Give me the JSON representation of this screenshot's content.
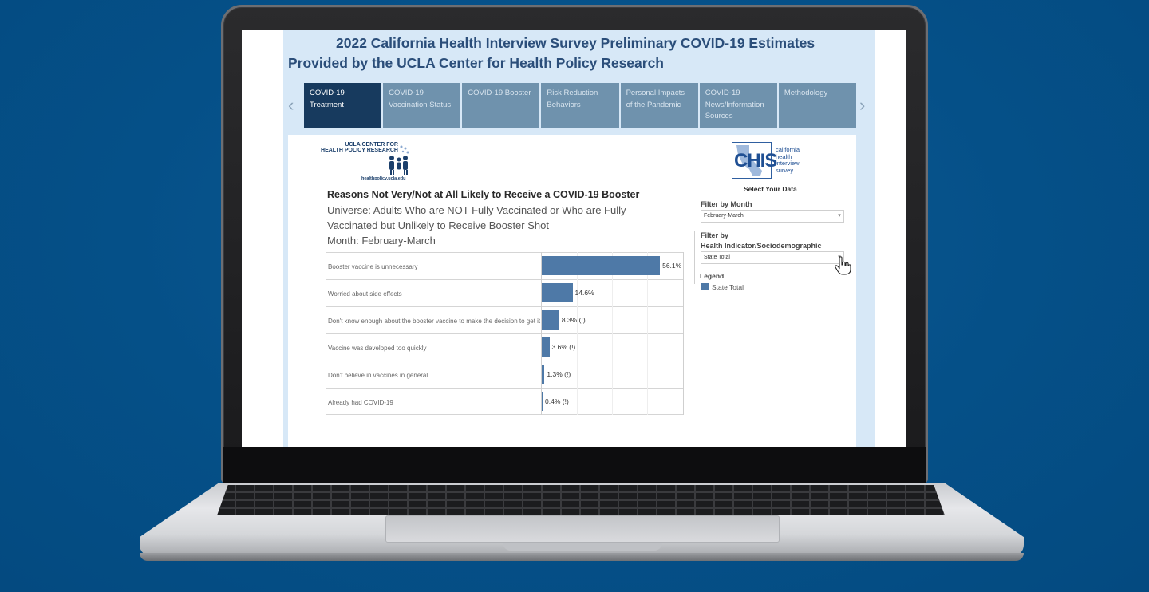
{
  "header": {
    "title_line1": "2022 California Health Interview Survey Preliminary COVID-19 Estimates",
    "title_line2": "Provided by the UCLA Center for Health Policy Research"
  },
  "tabs": [
    {
      "label": "COVID-19 Treatment",
      "active": true
    },
    {
      "label": "COVID-19 Vaccination Status",
      "active": false
    },
    {
      "label": "COVID-19 Booster",
      "active": false
    },
    {
      "label": "Risk Reduction Behaviors",
      "active": false
    },
    {
      "label": "Personal Impacts of the Pandemic",
      "active": false
    },
    {
      "label": "COVID-19 News/Information Sources",
      "active": false
    },
    {
      "label": "Methodology",
      "active": false
    }
  ],
  "nav": {
    "prev_icon": "chevron-left-icon",
    "next_icon": "chevron-right-icon"
  },
  "ucla_logo": {
    "line1": "UCLA CENTER FOR",
    "line2": "HEALTH POLICY RESEARCH",
    "url": "healthpolicy.ucla.edu"
  },
  "chis_logo": {
    "mark": "CHIS",
    "line1": "california",
    "line2": "health",
    "line3": "interview",
    "line4": "survey"
  },
  "filters": {
    "select_title": "Select Your Data",
    "month_label": "Filter by Month",
    "month_value": "February-March",
    "indicator_label1": "Filter by",
    "indicator_label2": "Health Indicator/Sociodemographic",
    "indicator_value": "State Total",
    "legend_title": "Legend",
    "legend_item": "State Total"
  },
  "chart_data": {
    "type": "bar",
    "orientation": "horizontal",
    "title": "Reasons Not Very/Not at All Likely to Receive a COVID-19 Booster",
    "subtitle_lines": [
      "Universe: Adults Who are NOT Fully Vaccinated or Who are Fully",
      "Vaccinated but Unlikely to Receive Booster Shot",
      "Month: February-March"
    ],
    "categories": [
      "Booster vaccine is unnecessary",
      "Worried about side effects",
      "Don't know enough about the booster vaccine to make the decision to get it",
      "Vaccine was developed too quickly",
      "Don't believe in vaccines in general",
      "Already had COVID-19"
    ],
    "series": [
      {
        "name": "State Total",
        "values": [
          56.1,
          14.6,
          8.3,
          3.6,
          1.3,
          0.4
        ],
        "color": "#4e79a7"
      }
    ],
    "value_labels": [
      "56.1%",
      "14.6%",
      "8.3% (!)",
      "3.6% (!)",
      "1.3% (!)",
      "0.4% (!)"
    ],
    "xlim": [
      0,
      100
    ],
    "grid": true
  }
}
